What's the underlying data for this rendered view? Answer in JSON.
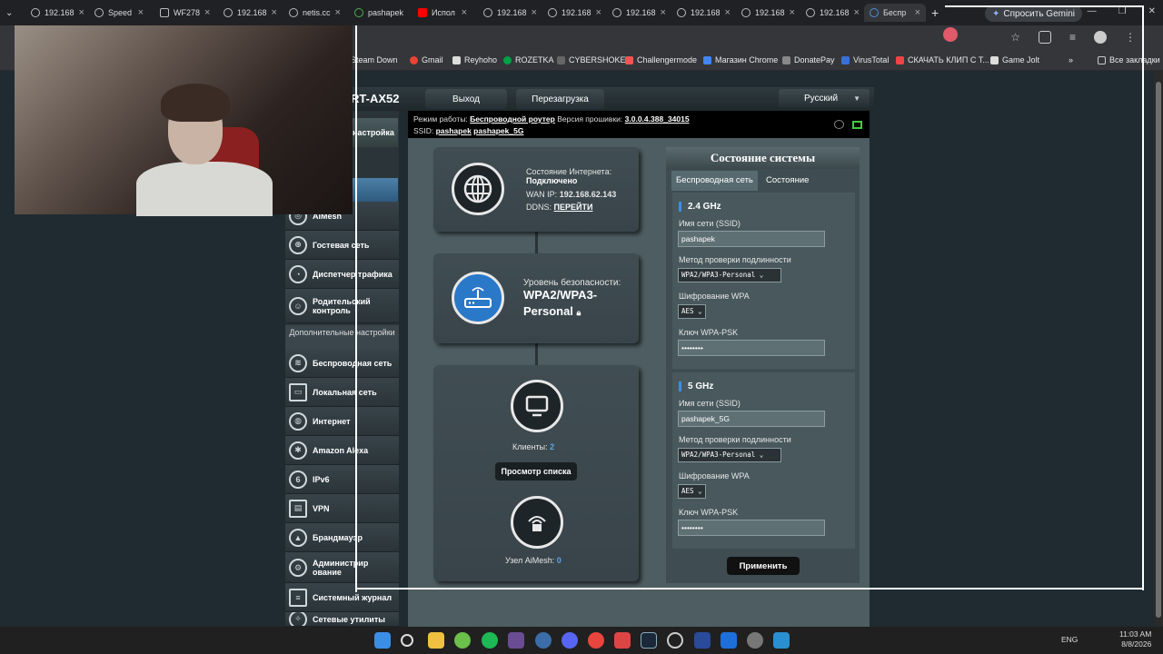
{
  "browser": {
    "tabs": [
      {
        "label": "192.168"
      },
      {
        "label": "Speed"
      },
      {
        "label": "WF278"
      },
      {
        "label": "192.168"
      },
      {
        "label": "netis.cc"
      },
      {
        "label": "pashapek"
      },
      {
        "label": "Испол"
      },
      {
        "label": "192.168"
      },
      {
        "label": "192.168"
      },
      {
        "label": "192.168"
      },
      {
        "label": "192.168"
      },
      {
        "label": "192.168"
      },
      {
        "label": "192.168"
      },
      {
        "label": "Беспр"
      }
    ],
    "gemini_label": "Спросить Gemini",
    "bookmarks": [
      "Steam Down",
      "Gmail",
      "Reyhoho",
      "ROZETKA",
      "CYBERSHOKE",
      "Challengermode",
      "Магазин Chrome",
      "DonatePay",
      "VirusTotal",
      "СКАЧАТЬ КЛИП С Т...",
      "Game Jolt"
    ],
    "bookmarks_more": "»",
    "all_bookmarks": "Все закладки"
  },
  "router": {
    "model": "RT-AX52",
    "logout": "Выход",
    "reboot": "Перезагрузка",
    "language": "Русский",
    "mode_label": "Режим работы:",
    "mode_value": "Беспроводной роутер",
    "firmware_label": "Версия прошивки:",
    "firmware_value": "3.0.0.4.388_34015",
    "ssid_label": "SSID:",
    "ssid_1": "pashapek",
    "ssid_2": "pashapek_5G"
  },
  "sidebar": {
    "quick_setup": "настройка",
    "items": [
      {
        "label": "AiMesh",
        "icon": "aimesh-icon"
      },
      {
        "label": "Гостевая сеть",
        "icon": "guest-network-icon"
      },
      {
        "label": "Диспетчер трафика",
        "icon": "traffic-manager-icon"
      },
      {
        "label": "Родительский контроль",
        "icon": "parental-control-icon"
      }
    ],
    "section_advanced": "Дополнительные настройки",
    "advanced_items": [
      {
        "label": "Беспроводная сеть",
        "icon": "wireless-icon"
      },
      {
        "label": "Локальная сеть",
        "icon": "lan-icon"
      },
      {
        "label": "Интернет",
        "icon": "wan-globe-icon"
      },
      {
        "label": "Amazon Alexa",
        "icon": "alexa-icon"
      },
      {
        "label": "IPv6",
        "icon": "ipv6-icon"
      },
      {
        "label": "VPN",
        "icon": "vpn-icon"
      },
      {
        "label": "Брандмауэр",
        "icon": "firewall-icon"
      },
      {
        "label": "Администрирование",
        "icon": "admin-icon"
      },
      {
        "label": "Системный журнал",
        "icon": "syslog-icon"
      },
      {
        "label": "Сетевые утилиты",
        "icon": "network-tools-icon"
      }
    ]
  },
  "map": {
    "internet_status_label": "Состояние Интернета:",
    "internet_status": "Подключено",
    "wan_ip_label": "WAN IP:",
    "wan_ip": "192.168.62.143",
    "ddns_label": "DDNS:",
    "ddns_link": "ПЕРЕЙТИ",
    "security_label": "Уровень безопасности:",
    "security_value_1": "WPA2/WPA3-",
    "security_value_2": "Personal",
    "clients_label": "Клиенты:",
    "clients_count": "2",
    "view_list": "Просмотр списка",
    "aimesh_node_label": "Узел AiMesh:",
    "aimesh_node_count": "0"
  },
  "status": {
    "title": "Состояние системы",
    "tab_wireless": "Беспроводная сеть",
    "tab_status": "Состояние",
    "band_24": {
      "name": "2.4 GHz",
      "ssid_label": "Имя сети (SSID)",
      "ssid": "pashapek",
      "auth_label": "Метод проверки подлинности",
      "auth": "WPA2/WPA3-Personal",
      "enc_label": "Шифрование WPA",
      "enc": "AES",
      "psk_label": "Ключ WPA-PSK",
      "psk": "••••••••"
    },
    "band_5": {
      "name": "5 GHz",
      "ssid_label": "Имя сети (SSID)",
      "ssid": "pashapek_5G",
      "auth_label": "Метод проверки подлинности",
      "auth": "WPA2/WPA3-Personal",
      "enc_label": "Шифрование WPA",
      "enc": "AES",
      "psk_label": "Ключ WPA-PSK",
      "psk": "••••••••"
    },
    "apply": "Применить"
  },
  "taskbar": {
    "lang": "ENG",
    "time": "11:03 AM",
    "date": "8/8/2026"
  }
}
